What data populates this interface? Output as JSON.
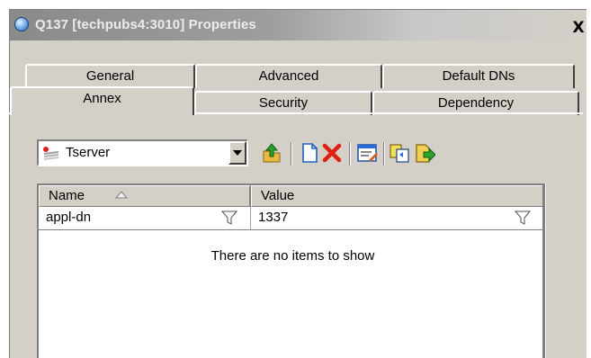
{
  "window": {
    "title": "Q137 [techpubs4:3010] Properties",
    "close_label": "X"
  },
  "tabs_back_row": [
    {
      "label": "General"
    },
    {
      "label": "Advanced"
    },
    {
      "label": "Default DNs"
    }
  ],
  "tabs_front_row": [
    {
      "label": "Annex",
      "active": true
    },
    {
      "label": "Security"
    },
    {
      "label": "Dependency"
    }
  ],
  "section_selector": {
    "value": "Tserver",
    "icon": "section-icon"
  },
  "toolbar": {
    "icons": [
      "up-folder-icon",
      "new-document-icon",
      "delete-icon",
      "edit-icon",
      "copy-icon",
      "export-icon"
    ]
  },
  "grid": {
    "columns": [
      {
        "label": "Name",
        "sorted": "ascending"
      },
      {
        "label": "Value"
      }
    ],
    "filter_row": {
      "name": "appl-dn",
      "value": "1337"
    },
    "empty_message": "There are no items to show"
  }
}
